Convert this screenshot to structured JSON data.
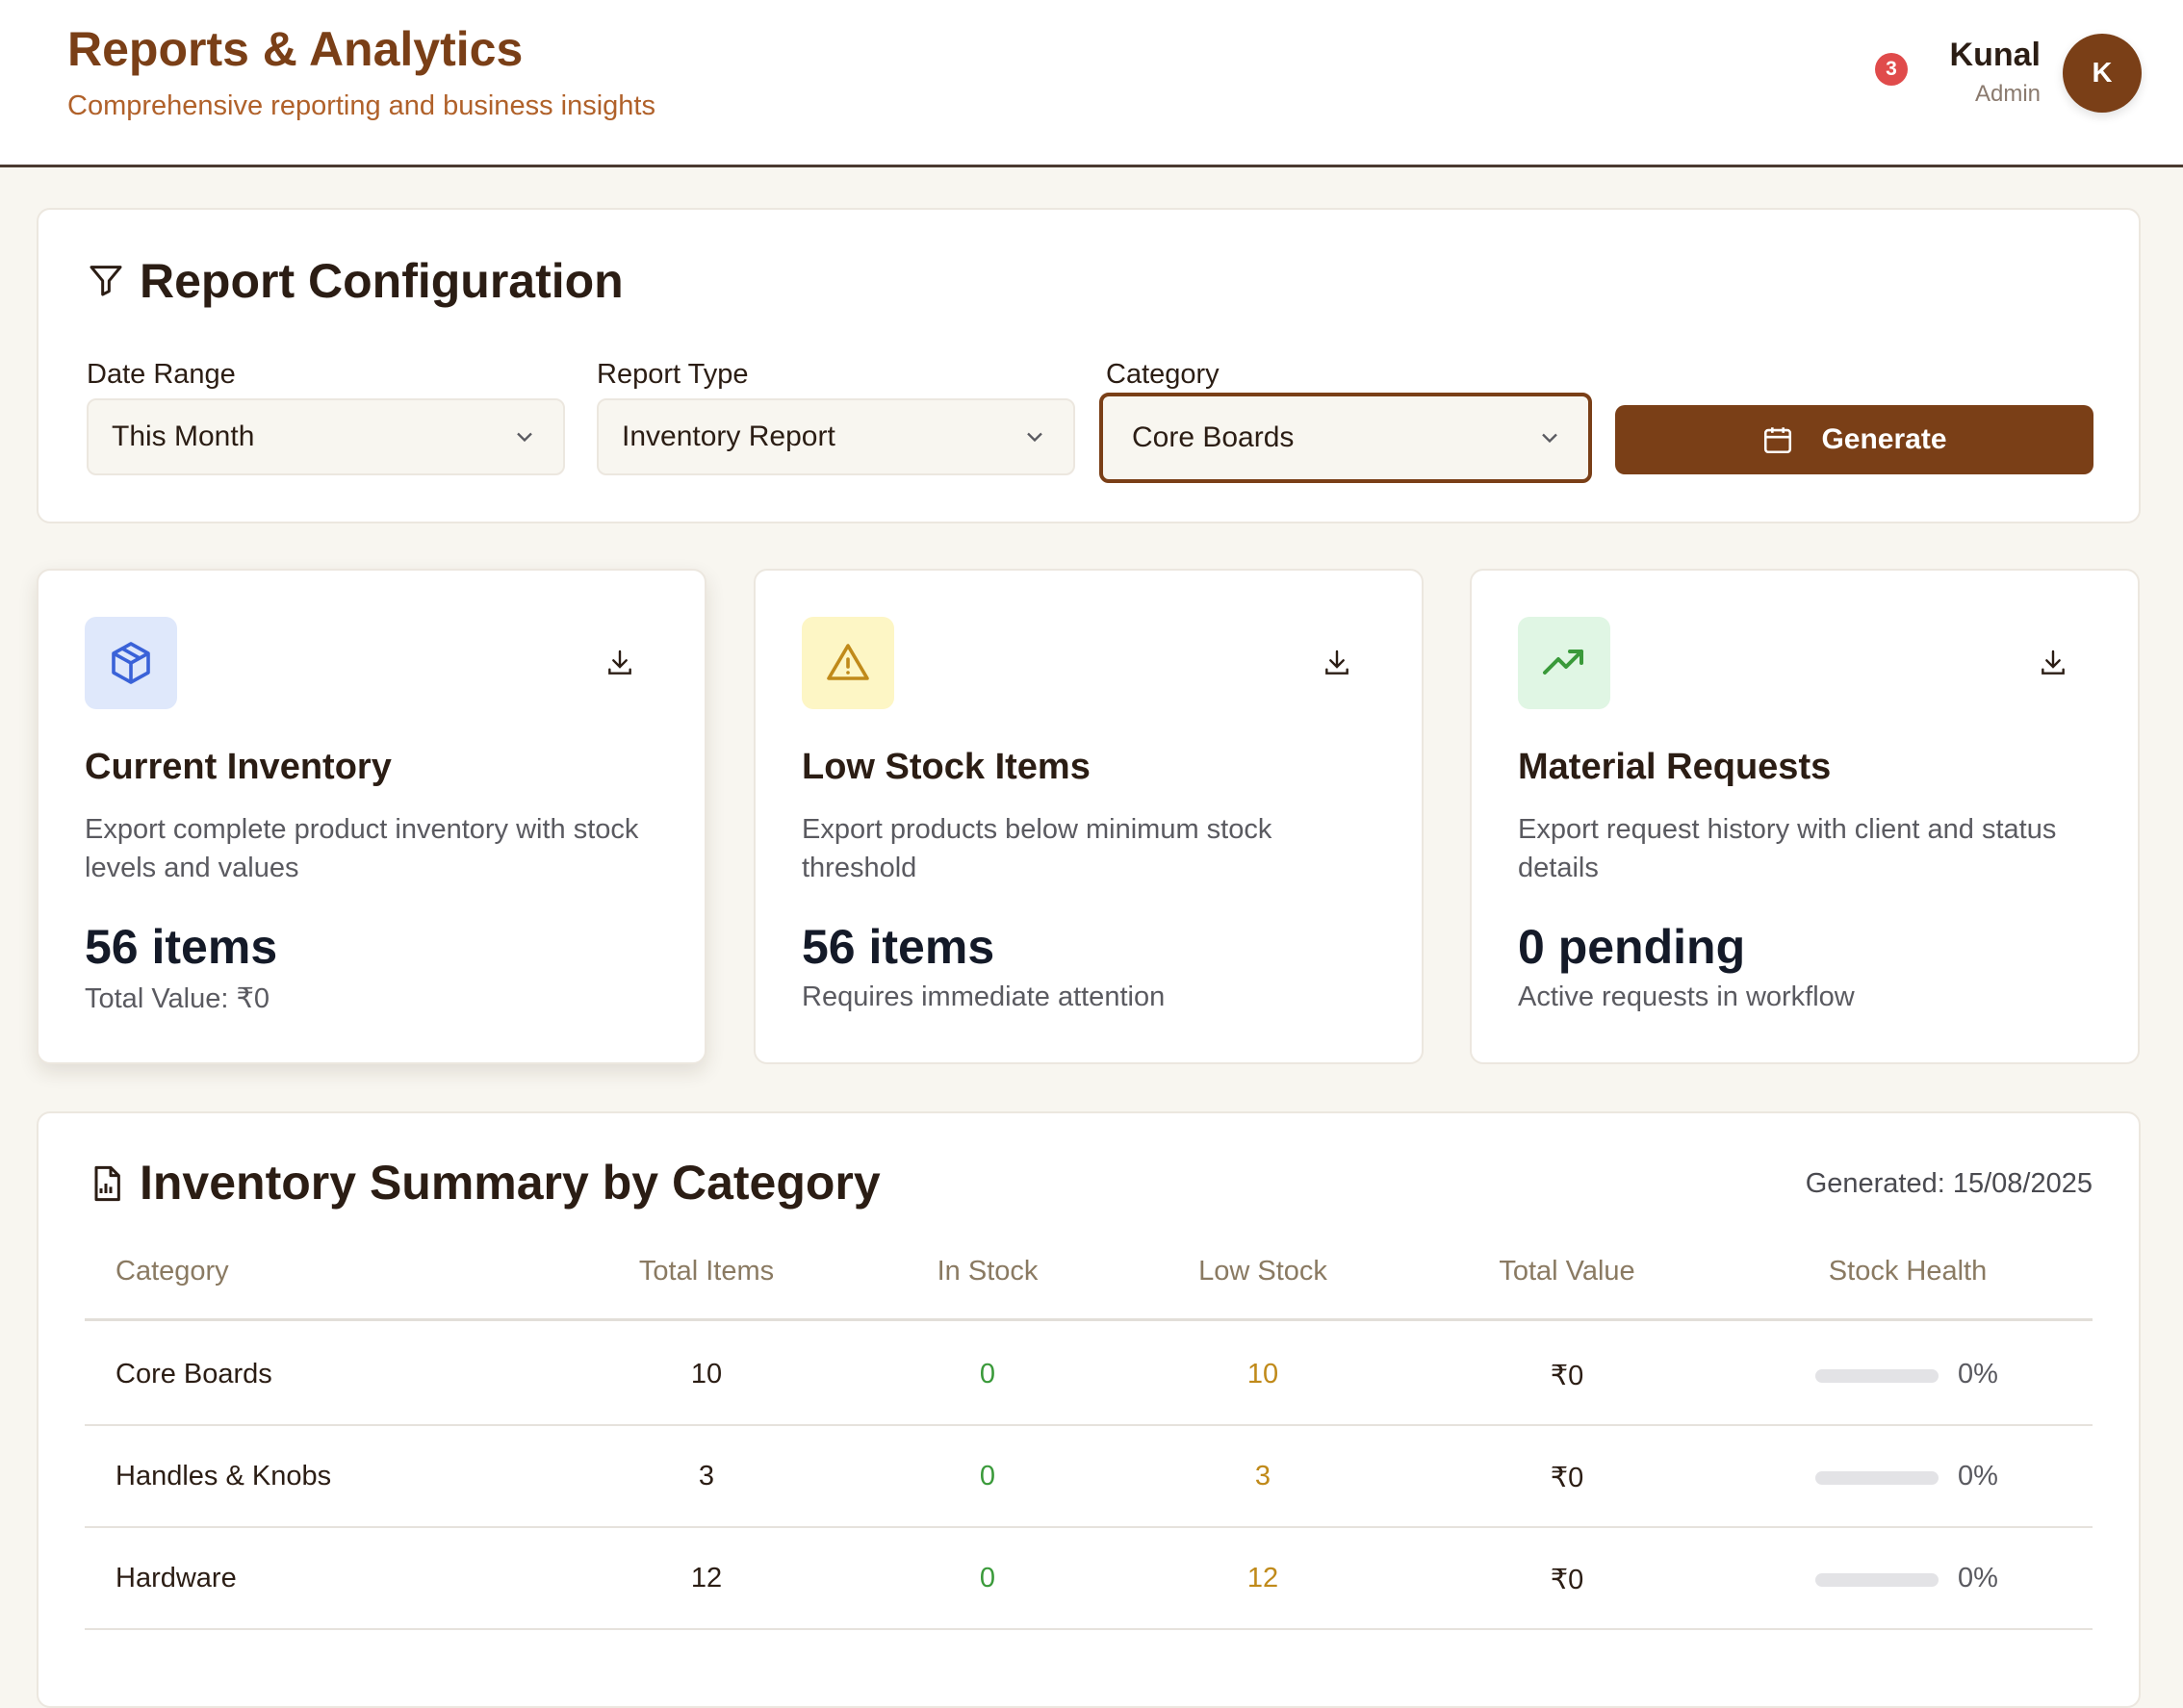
{
  "header": {
    "title": "Reports & Analytics",
    "subtitle": "Comprehensive reporting and business insights",
    "notifications": "3",
    "user_name": "Kunal",
    "user_role": "Admin",
    "avatar_initial": "K"
  },
  "config": {
    "title": "Report Configuration",
    "date_range_label": "Date Range",
    "date_range_value": "This Month",
    "report_type_label": "Report Type",
    "report_type_value": "Inventory Report",
    "category_label": "Category",
    "category_value": "Core Boards",
    "generate_label": "Generate"
  },
  "reports": [
    {
      "title": "Current Inventory",
      "description": "Export complete product inventory with stock levels and values",
      "value": "56 items",
      "sub": "Total Value: ₹0",
      "icon": "box-icon",
      "icon_bg": "#dfe8fb",
      "icon_color": "#3a62d8"
    },
    {
      "title": "Low Stock Items",
      "description": "Export products below minimum stock threshold",
      "value": "56 items",
      "sub": "Requires immediate attention",
      "icon": "warning-icon",
      "icon_bg": "#fdf6c5",
      "icon_color": "#c08a1a"
    },
    {
      "title": "Material Requests",
      "description": "Export request history with client and status details",
      "value": "0 pending",
      "sub": "Active requests in workflow",
      "icon": "trending-up-icon",
      "icon_bg": "#e0f6e4",
      "icon_color": "#3a9a3a"
    }
  ],
  "summary": {
    "title": "Inventory Summary by Category",
    "generated": "Generated: 15/08/2025",
    "columns": [
      "Category",
      "Total Items",
      "In Stock",
      "Low Stock",
      "Total Value",
      "Stock Health"
    ],
    "rows": [
      {
        "category": "Core Boards",
        "total": "10",
        "in_stock": "0",
        "low_stock": "10",
        "value": "₹0",
        "health": "0%",
        "health_fraction": 0
      },
      {
        "category": "Handles & Knobs",
        "total": "3",
        "in_stock": "0",
        "low_stock": "3",
        "value": "₹0",
        "health": "0%",
        "health_fraction": 0
      },
      {
        "category": "Hardware",
        "total": "12",
        "in_stock": "0",
        "low_stock": "12",
        "value": "₹0",
        "health": "0%",
        "health_fraction": 0
      }
    ]
  }
}
